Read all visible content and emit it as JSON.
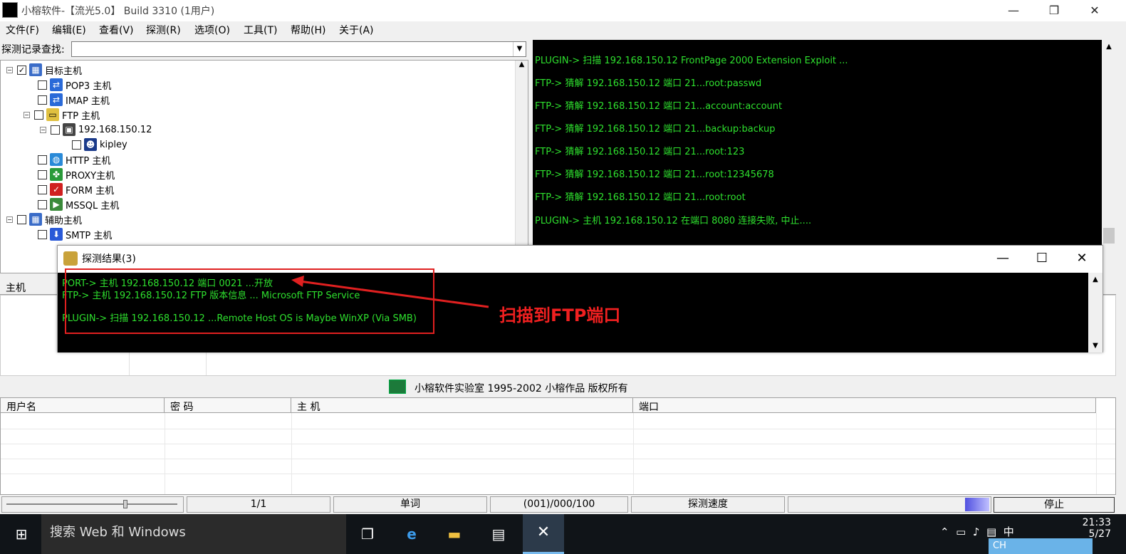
{
  "window": {
    "title": "小榕软件-【流光5.0】 Build 3310 (1用户)"
  },
  "menu": [
    "文件(F)",
    "编辑(E)",
    "查看(V)",
    "探测(R)",
    "选项(O)",
    "工具(T)",
    "帮助(H)",
    "关于(A)"
  ],
  "search": {
    "label": "探测记录查找:",
    "value": ""
  },
  "tree": {
    "root": "目标主机",
    "pop3": "POP3 主机",
    "imap": "IMAP 主机",
    "ftp": "FTP 主机",
    "ftp_host": "192.168.150.12",
    "ftp_user": "kipley",
    "http": "HTTP 主机",
    "proxy": "PROXY主机",
    "form": "FORM 主机",
    "mssql": "MSSQL 主机",
    "aux": "辅助主机",
    "smtp": "SMTP 主机"
  },
  "console": [
    "PLUGIN-> 扫描 192.168.150.12 FrontPage 2000 Extension Exploit ...",
    "FTP-> 猜解 192.168.150.12 端口 21...root:passwd",
    "FTP-> 猜解 192.168.150.12 端口 21...account:account",
    "FTP-> 猜解 192.168.150.12 端口 21...backup:backup",
    "FTP-> 猜解 192.168.150.12 端口 21...root:123",
    "FTP-> 猜解 192.168.150.12 端口 21...root:12345678",
    "FTP-> 猜解 192.168.150.12 端口 21...root:root",
    "PLUGIN-> 主机 192.168.150.12 在端口 8080 连接失败, 中止...."
  ],
  "dialog": {
    "title": "探测结果(3)",
    "lines": [
      "PORT-> 主机 192.168.150.12 端口 0021 ...开放",
      "FTP-> 主机 192.168.150.12 FTP 版本信息 ... Microsoft FTP Service",
      "PLUGIN-> 扫描 192.168.150.12 ...Remote Host OS is Maybe WinXP (Via SMB)"
    ],
    "annotation": "扫描到FTP端口"
  },
  "mid": {
    "col1": "主机"
  },
  "banner": "小榕软件实验室 1995-2002 小榕作品 版权所有",
  "table": {
    "headers": [
      "用户名",
      "密 码",
      "主 机",
      "端口"
    ]
  },
  "status": {
    "page": "1/1",
    "mode": "单词",
    "progress": "(001)/000/100",
    "speed_label": "探测速度",
    "stop": "停止"
  },
  "taskbar": {
    "search": "搜索 Web 和 Windows",
    "time": "21:33",
    "date": "5/27",
    "ime": "CH"
  }
}
